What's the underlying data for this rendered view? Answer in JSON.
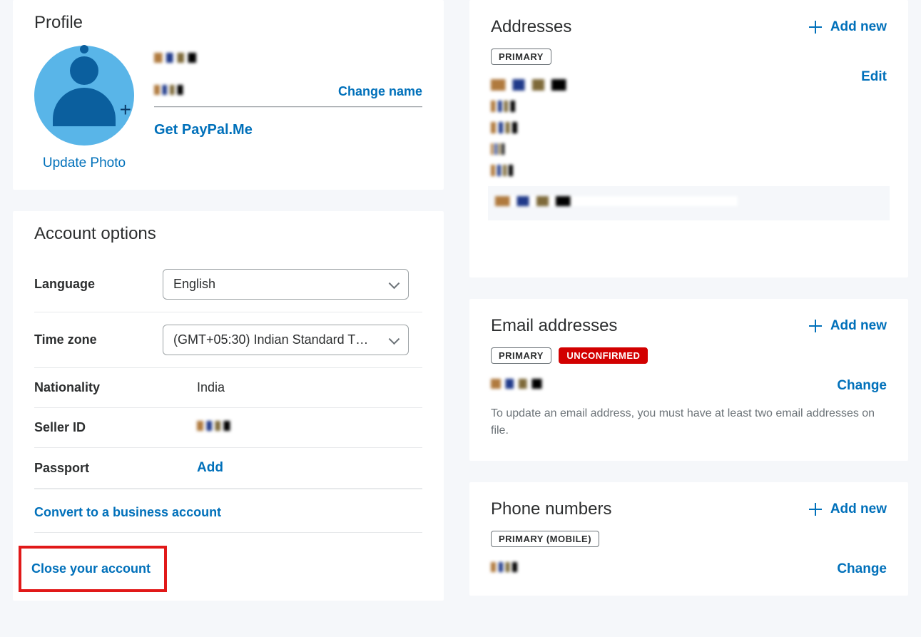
{
  "profile": {
    "title": "Profile",
    "update_photo": "Update Photo",
    "change_name": "Change name",
    "get_paypal_me": "Get PayPal.Me"
  },
  "account_options": {
    "title": "Account options",
    "language_label": "Language",
    "language_value": "English",
    "timezone_label": "Time zone",
    "timezone_value": "(GMT+05:30) Indian Standard T…",
    "nationality_label": "Nationality",
    "nationality_value": "India",
    "seller_id_label": "Seller ID",
    "passport_label": "Passport",
    "passport_add": "Add",
    "convert_link": "Convert to a business account",
    "close_link": "Close your account"
  },
  "addresses": {
    "title": "Addresses",
    "add_new": "Add new",
    "primary_badge": "PRIMARY",
    "edit": "Edit"
  },
  "emails": {
    "title": "Email addresses",
    "add_new": "Add new",
    "primary_badge": "PRIMARY",
    "unconfirmed_badge": "UNCONFIRMED",
    "change": "Change",
    "hint": "To update an email address, you must have at least two email addresses on file."
  },
  "phones": {
    "title": "Phone numbers",
    "add_new": "Add new",
    "primary_mobile_badge": "PRIMARY (MOBILE)",
    "change": "Change"
  }
}
